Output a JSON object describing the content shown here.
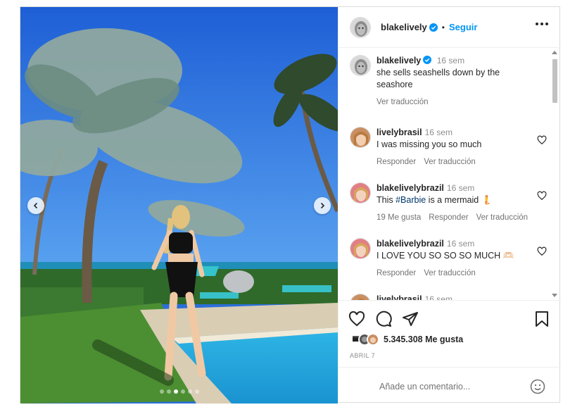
{
  "post": {
    "author": "blakelively",
    "separator": "•",
    "follow_label": "Seguir",
    "caption": {
      "username": "blakelively",
      "time": "16 sem",
      "text": "she sells seashells down by the seashore",
      "translate": "Ver traducción"
    },
    "likes_text": "5.345.308 Me gusta",
    "date": "ABRIL 7",
    "carousel": {
      "slide_count": 6,
      "active_slide": 3
    }
  },
  "comments": [
    {
      "username": "livelybrasil",
      "time": "16 sem",
      "text": "I was missing you so much",
      "likes": "",
      "reply": "Responder",
      "translate": "Ver traducción"
    },
    {
      "username": "blakelivelybrazil",
      "time": "16 sem",
      "text_before": "This ",
      "hashtag": "#Barbie",
      "text_after": " is a mermaid 🧜",
      "likes": "19 Me gusta",
      "reply": "Responder",
      "translate": "Ver traducción"
    },
    {
      "username": "blakelivelybrazil",
      "time": "16 sem",
      "text": "I LOVE YOU SO SO SO MUCH 🫶🏻",
      "likes": "",
      "reply": "Responder",
      "translate": "Ver traducción"
    },
    {
      "username": "livelybrasil",
      "time": "16 sem"
    }
  ],
  "add_comment": {
    "placeholder": "Añade un comentario..."
  },
  "icons": {
    "more": "more-options-icon",
    "like": "heart-icon",
    "comment": "comment-icon",
    "share": "share-icon",
    "save": "bookmark-icon",
    "emoji": "emoji-icon",
    "verified": "verified-badge-icon",
    "prev": "chevron-left-icon",
    "next": "chevron-right-icon"
  },
  "colors": {
    "accent": "#0095f6",
    "verified": "#0095f6",
    "text": "#262626",
    "muted": "#737373",
    "border": "#dbdbdb"
  }
}
